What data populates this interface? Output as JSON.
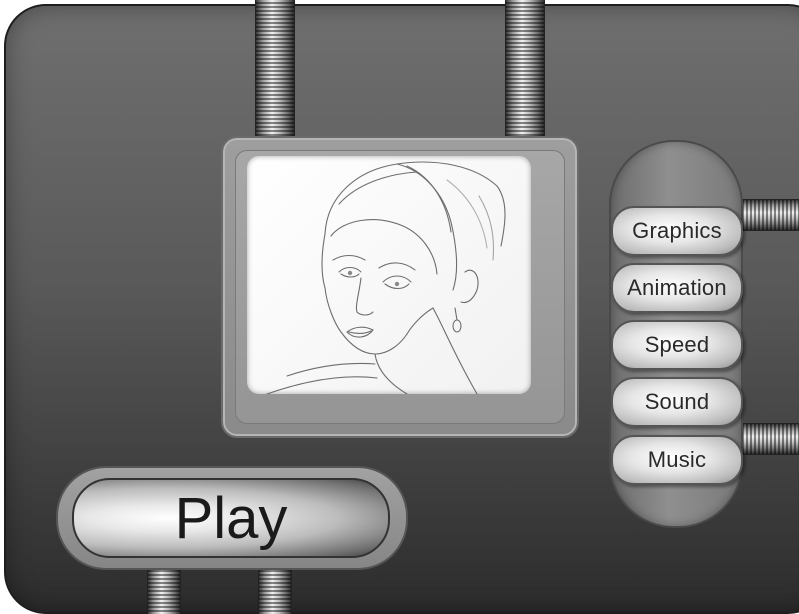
{
  "menu": {
    "items": [
      {
        "label": "Graphics"
      },
      {
        "label": "Animation"
      },
      {
        "label": "Speed"
      },
      {
        "label": "Sound"
      },
      {
        "label": "Music"
      }
    ]
  },
  "play": {
    "label": "Play"
  },
  "preview": {
    "content": "pencil-sketch-portrait-woman"
  },
  "colors": {
    "panel": "#5a5a5a",
    "button_face": "#e6e6e6",
    "text": "#2a2a2a"
  }
}
